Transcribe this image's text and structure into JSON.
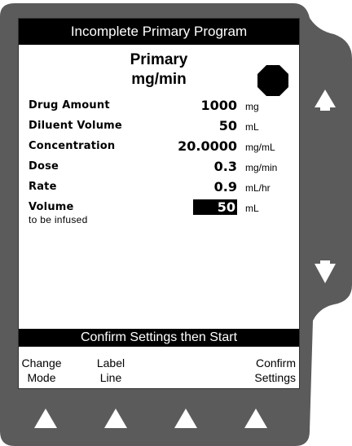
{
  "screen": {
    "title": "Incomplete Primary Program",
    "header_line1": "Primary",
    "header_line2": "mg/min"
  },
  "rows": [
    {
      "label": "Drug Amount",
      "value": "1000",
      "unit": "mg"
    },
    {
      "label": "Diluent Volume",
      "value": "50",
      "unit": "mL"
    },
    {
      "label": "Concentration",
      "value": "20.0000",
      "unit": "mg/mL"
    },
    {
      "label": "Dose",
      "value": "0.3",
      "unit": "mg/min"
    },
    {
      "label": "Rate",
      "value": "0.9",
      "unit": "mL/hr"
    },
    {
      "label": "Volume",
      "value": "50",
      "unit": "mL"
    }
  ],
  "volume_sublabel": "to be infused",
  "confirm_banner": "Confirm Settings then Start",
  "softkeys": {
    "change_mode": [
      "Change",
      "Mode"
    ],
    "label_line": [
      "Label",
      "Line"
    ],
    "confirm_settings": [
      "Confirm",
      "Settings"
    ]
  },
  "colors": {
    "bezel": "#5a5a5a",
    "screen_bg": "#ffffff",
    "highlight": "#000000"
  },
  "icons": [
    "stop-octagon-icon",
    "up-arrow-icon",
    "down-arrow-icon",
    "softkey-triangle-icon"
  ]
}
